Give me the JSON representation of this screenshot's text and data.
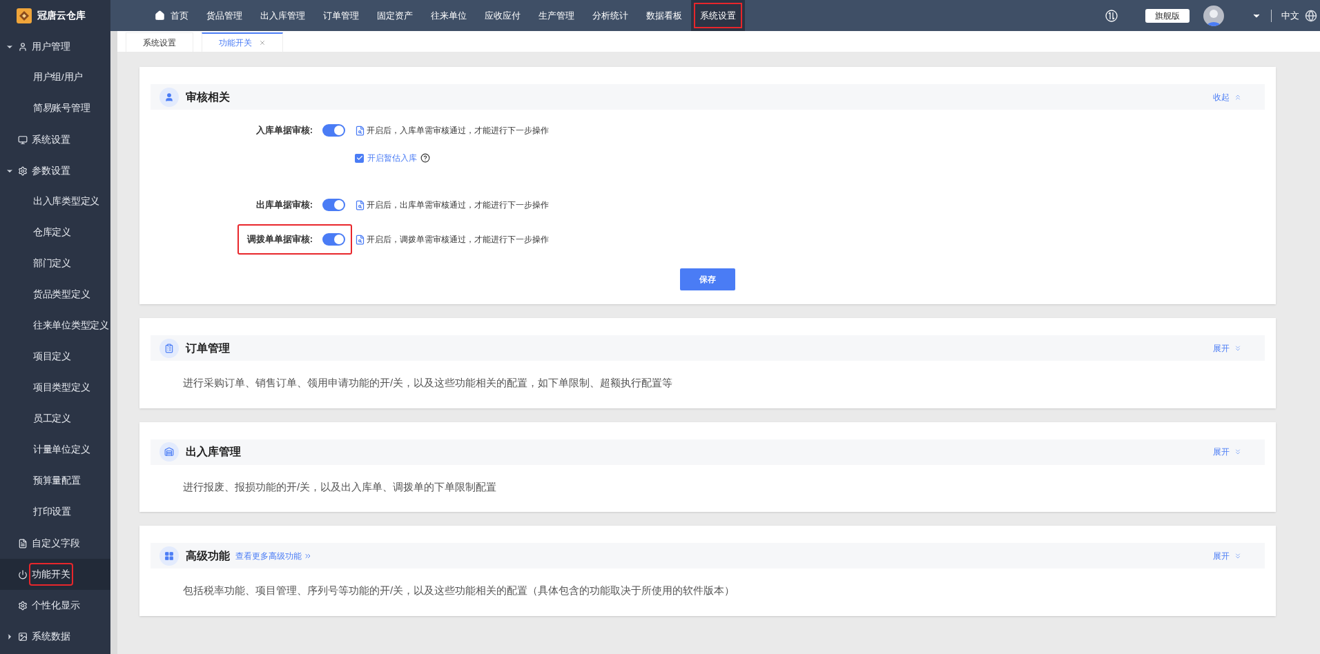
{
  "logo": {
    "text": "冠唐云仓库"
  },
  "nav": [
    {
      "label": "首页",
      "selected": false,
      "highlighted": false,
      "kind": "home"
    },
    {
      "label": "货品管理",
      "selected": false,
      "highlighted": false
    },
    {
      "label": "出入库管理",
      "selected": false,
      "highlighted": false
    },
    {
      "label": "订单管理",
      "selected": false,
      "highlighted": false
    },
    {
      "label": "固定资产",
      "selected": false,
      "highlighted": false
    },
    {
      "label": "往来单位",
      "selected": false,
      "highlighted": false
    },
    {
      "label": "应收应付",
      "selected": false,
      "highlighted": false
    },
    {
      "label": "生产管理",
      "selected": false,
      "highlighted": false
    },
    {
      "label": "分析统计",
      "selected": false,
      "highlighted": false
    },
    {
      "label": "数据看板",
      "selected": false,
      "highlighted": false
    },
    {
      "label": "系统设置",
      "selected": true,
      "highlighted": true
    }
  ],
  "header_right": {
    "edition": "旗舰版",
    "language": "中文"
  },
  "sidebar": {
    "items": [
      {
        "label": "用户管理",
        "selected": false,
        "highlighted": false,
        "expanded": true,
        "children": [
          {
            "label": "用户组/用户",
            "selected": false,
            "highlighted": false
          },
          {
            "label": "简易账号管理",
            "selected": false,
            "highlighted": false
          }
        ]
      },
      {
        "label": "系统设置",
        "selected": false,
        "highlighted": false
      },
      {
        "label": "参数设置",
        "selected": false,
        "highlighted": false,
        "expanded": true,
        "children": [
          {
            "label": "出入库类型定义",
            "selected": false,
            "highlighted": false
          },
          {
            "label": "仓库定义",
            "selected": false,
            "highlighted": false
          },
          {
            "label": "部门定义",
            "selected": false,
            "highlighted": false
          },
          {
            "label": "货品类型定义",
            "selected": false,
            "highlighted": false
          },
          {
            "label": "往来单位类型定义",
            "selected": false,
            "highlighted": false
          },
          {
            "label": "项目定义",
            "selected": false,
            "highlighted": false
          },
          {
            "label": "项目类型定义",
            "selected": false,
            "highlighted": false
          },
          {
            "label": "员工定义",
            "selected": false,
            "highlighted": false
          },
          {
            "label": "计量单位定义",
            "selected": false,
            "highlighted": false
          },
          {
            "label": "预算量配置",
            "selected": false,
            "highlighted": false
          },
          {
            "label": "打印设置",
            "selected": false,
            "highlighted": false
          }
        ]
      },
      {
        "label": "自定义字段",
        "selected": false,
        "highlighted": false
      },
      {
        "label": "功能开关",
        "selected": true,
        "highlighted": true
      },
      {
        "label": "个性化显示",
        "selected": false,
        "highlighted": false
      },
      {
        "label": "系统数据",
        "selected": false,
        "highlighted": false,
        "expanded": false
      }
    ]
  },
  "tabs": [
    {
      "label": "系统设置",
      "selected": false,
      "closable": false
    },
    {
      "label": "功能开关",
      "selected": true,
      "closable": true
    }
  ],
  "sections": [
    {
      "title": "审核相关",
      "expanded": true,
      "toggle_label": "收起",
      "rows": [
        {
          "label": "入库单据审核:",
          "on": true,
          "hint": "开启后，入库单需审核通过，才能进行下一步操作",
          "highlighted": false,
          "option": {
            "label": "开启暂估入库",
            "checked": true
          }
        },
        {
          "label": "出库单据审核:",
          "on": true,
          "hint": "开启后，出库单需审核通过，才能进行下一步操作",
          "highlighted": false
        },
        {
          "label": "调拨单单据审核:",
          "on": true,
          "hint": "开启后，调拨单需审核通过，才能进行下一步操作",
          "highlighted": true
        }
      ],
      "save_button": "保存"
    },
    {
      "title": "订单管理",
      "expanded": false,
      "toggle_label": "展开",
      "description": "进行采购订单、销售订单、领用申请功能的开/关，以及这些功能相关的配置，如下单限制、超额执行配置等"
    },
    {
      "title": "出入库管理",
      "expanded": false,
      "toggle_label": "展开",
      "description": "进行报废、报损功能的开/关，以及出入库单、调拨单的下单限制配置"
    },
    {
      "title": "高级功能",
      "expanded": false,
      "toggle_label": "展开",
      "link": "查看更多高级功能",
      "description": "包括税率功能、项目管理、序列号等功能的开/关，以及这些功能相关的配置（具体包含的功能取决于所使用的软件版本）"
    }
  ]
}
